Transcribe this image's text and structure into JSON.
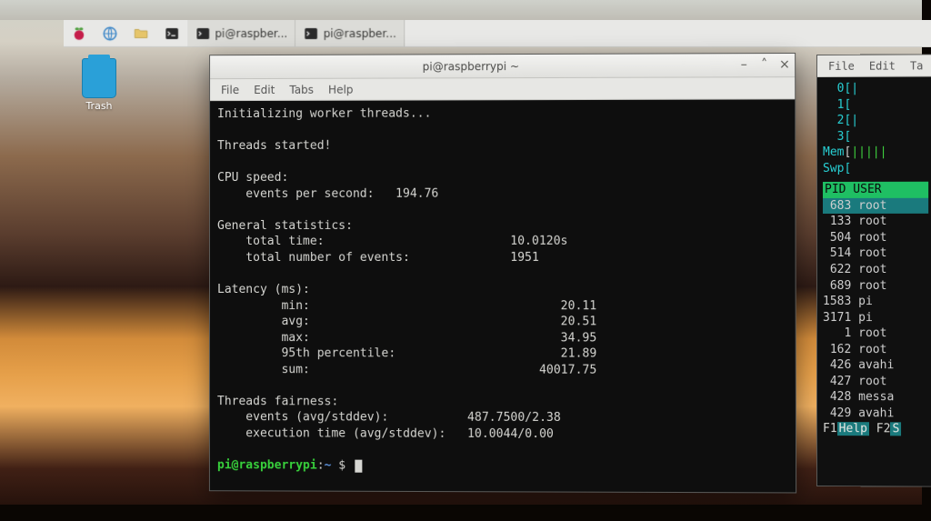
{
  "taskbar": {
    "tasks": [
      {
        "icon": "terminal",
        "label": "pi@raspber..."
      },
      {
        "icon": "terminal",
        "label": "pi@raspber..."
      }
    ]
  },
  "desktop": {
    "trash_label": "Trash"
  },
  "main_window": {
    "title": "pi@raspberrypi ~",
    "menus": {
      "file": "File",
      "edit": "Edit",
      "tabs": "Tabs",
      "help": "Help"
    },
    "output": {
      "l01": "Initializing worker threads...",
      "l02": "",
      "l03": "Threads started!",
      "l04": "",
      "l05": "CPU speed:",
      "l06": "    events per second:   194.76",
      "l07": "",
      "l08": "General statistics:",
      "l09": "    total time:                          10.0120s",
      "l10": "    total number of events:              1951",
      "l11": "",
      "l12": "Latency (ms):",
      "l13": "         min:                                   20.11",
      "l14": "         avg:                                   20.51",
      "l15": "         max:                                   34.95",
      "l16": "         95th percentile:                       21.89",
      "l17": "         sum:                                40017.75",
      "l18": "",
      "l19": "Threads fairness:",
      "l20": "    events (avg/stddev):           487.7500/2.38",
      "l21": "    execution time (avg/stddev):   10.0044/0.00",
      "l22": ""
    },
    "prompt_user": "pi@raspberrypi",
    "prompt_sep": ":",
    "prompt_path": "~",
    "prompt_dollar": " $ "
  },
  "htop": {
    "menus": {
      "file": "File",
      "edit": "Edit",
      "tabs": "Ta"
    },
    "cpu0": "  0[|",
    "cpu1": "  1[",
    "cpu2": "  2[|",
    "cpu3": "  3[",
    "mem": "Mem[|||||",
    "swp": "Swp[",
    "header": " PID USER  ",
    "rows": [
      " 683 root",
      " 133 root",
      " 504 root",
      " 514 root",
      " 622 root",
      " 689 root",
      "1583 pi",
      "3171 pi",
      "   1 root",
      " 162 root",
      " 426 avahi",
      " 427 root",
      " 428 messa",
      " 429 avahi"
    ],
    "f1_key": "F1",
    "f1_lbl": "Help",
    "f2_key": "F2",
    "f2_lbl": "S"
  }
}
